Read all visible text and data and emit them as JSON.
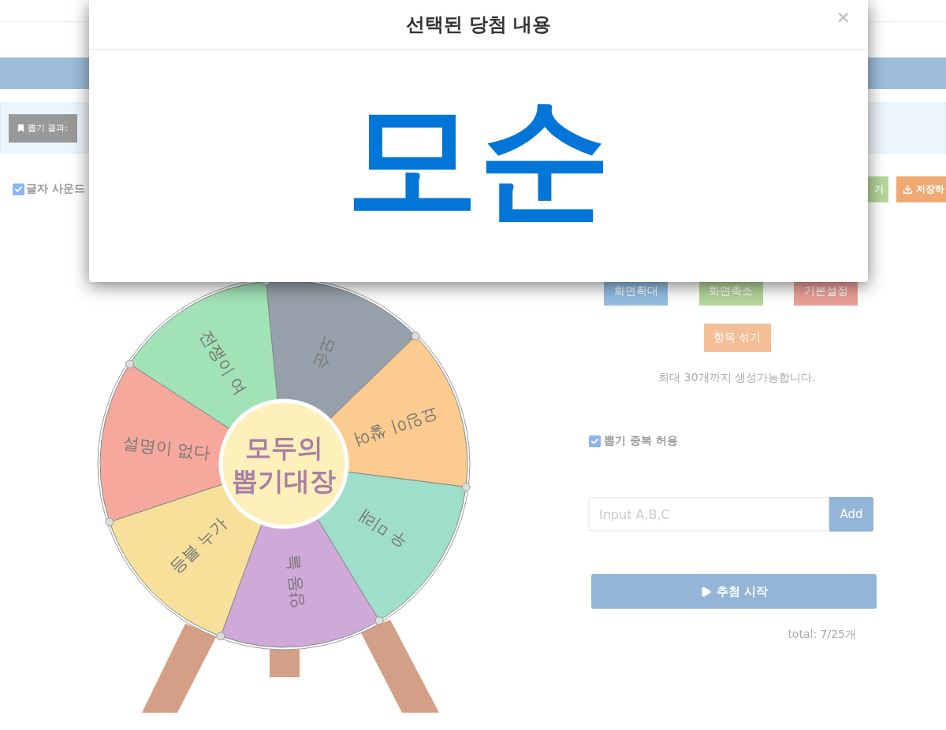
{
  "modal": {
    "title": "선택된 당첨 내용",
    "close": "×",
    "result": "모순"
  },
  "result_bar": {
    "label": "뽑기 결과:"
  },
  "sound_option": {
    "label": "글자 사운드",
    "checked": true
  },
  "top_buttons": [
    {
      "label": "기",
      "kind": "success"
    },
    {
      "label": "저장하",
      "kind": "save"
    }
  ],
  "wheel": {
    "center_text": [
      "모두의",
      "뽑기대장"
    ],
    "segments": [
      {
        "label": "모순",
        "color": "#96a0aa"
      },
      {
        "label": "요잉이 쌓여",
        "color": "#fccb8f"
      },
      {
        "label": "우 미래",
        "color": "#9fdecb"
      },
      {
        "label": "양몽 늘",
        "color": "#cfaad9"
      },
      {
        "label": "등불 누가",
        "color": "#f7e19a"
      },
      {
        "label": "설명이 없다",
        "color": "#f6a89d"
      },
      {
        "label": "전쟁이 여",
        "color": "#a1e2b7"
      }
    ]
  },
  "view_buttons": [
    {
      "label": "화면확대",
      "kind": "primary"
    },
    {
      "label": "화면축소",
      "kind": "success"
    },
    {
      "label": "기본설정",
      "kind": "danger"
    }
  ],
  "shuffle_button": "항목 섞기",
  "limit_note": "최대 30개까지 생성가능합니다.",
  "duplicate_option": {
    "label": "뽑기 중복 허용",
    "checked": true
  },
  "add_field": {
    "placeholder": "Input A,B,C"
  },
  "add_button": "Add",
  "start_button": "추첨 시작",
  "total": "total: 7/25개"
}
